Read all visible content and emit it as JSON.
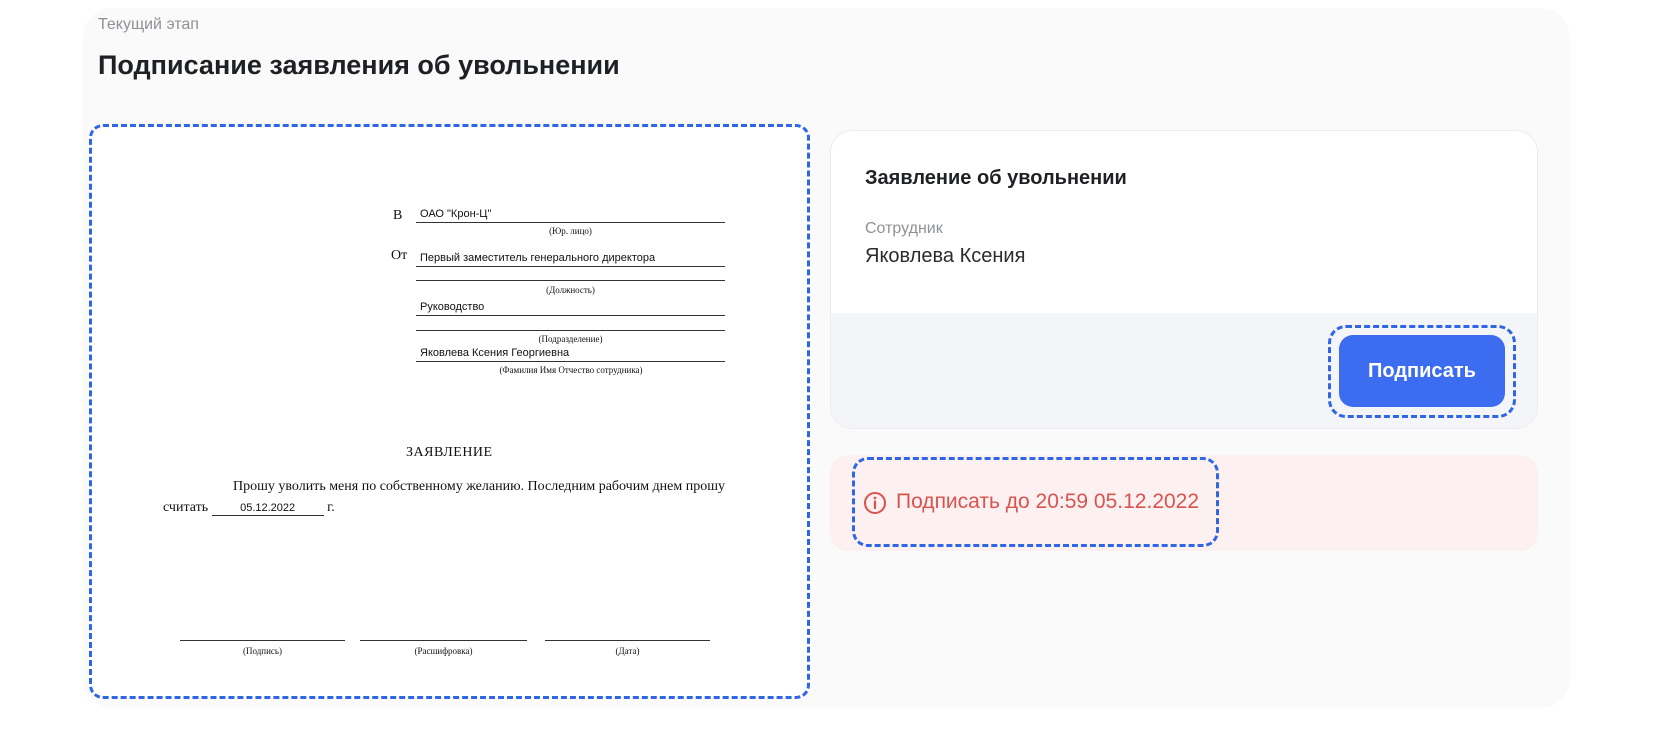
{
  "header": {
    "stage_label": "Текущий этап",
    "title": "Подписание заявления об увольнении"
  },
  "document": {
    "to_prefix": "В",
    "from_prefix": "От",
    "company": "ОАО \"Крон-Ц\"",
    "company_caption": "(Юр. лицо)",
    "position": "Первый заместитель генерального директора",
    "position_caption": "(Должность)",
    "department": "Руководство",
    "department_caption": "(Подразделение)",
    "full_name": "Яковлева Ксения Георгиевна",
    "full_name_caption": "(Фамилия Имя Отчество сотрудника)",
    "heading": "ЗАЯВЛЕНИЕ",
    "body_line1": "Прошу уволить меня по собственному желанию. Последним рабочим днем прошу",
    "body_line2_prefix": "считать",
    "last_day": "05.12.2022",
    "body_line2_suffix": "г.",
    "sig_caption": "(Подпись)",
    "decode_caption": "(Расшифровка)",
    "date_caption": "(Дата)"
  },
  "card": {
    "title": "Заявление об увольнении",
    "employee_label": "Сотрудник",
    "employee_name": "Яковлева Ксения",
    "sign_button": "Подписать"
  },
  "deadline": {
    "icon": "info-circle-icon",
    "text": "Подписать до 20:59 05.12.2022",
    "color": "#d9534f"
  },
  "colors": {
    "accent": "#3c6df0",
    "highlight_outline": "#2f66e6",
    "deadline_bg": "#fdf0f0"
  }
}
